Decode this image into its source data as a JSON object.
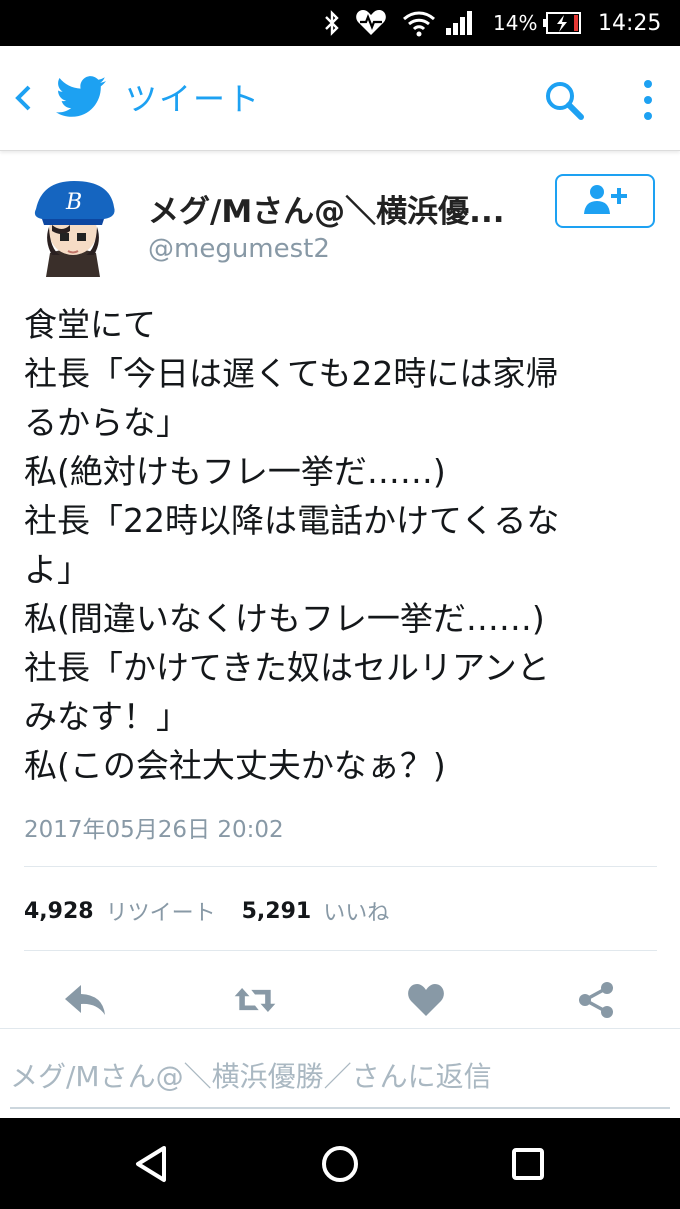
{
  "status_bar": {
    "battery_text": "14%",
    "time": "14:25",
    "icons": [
      "bluetooth-icon",
      "heart-monitor-icon",
      "wifi-icon",
      "signal-icon",
      "battery-icon"
    ]
  },
  "app_bar": {
    "title": "ツイート",
    "icons": [
      "back-icon",
      "twitter-bird-icon",
      "search-icon",
      "more-vert-icon"
    ],
    "accent_color": "#1da1f2"
  },
  "tweet": {
    "author_name": "メグ/Mさん@＼横浜優...",
    "author_handle": "@megumest2",
    "text_lines": [
      "食堂にて",
      "社長「今日は遅くても22時には家帰",
      "るからな」",
      "私(絶対けもフレ一挙だ……)",
      "社長「22時以降は電話かけてくるな",
      "よ」",
      "私(間違いなくけもフレ一挙だ……)",
      "社長「かけてきた奴はセルリアンと",
      "みなす！」",
      "私(この会社大丈夫かなぁ？)"
    ],
    "timestamp": "2017年05月26日 20:02",
    "retweet_count": "4,928",
    "retweet_label": "リツイート",
    "like_count": "5,291",
    "like_label": "いいね"
  },
  "actions": [
    "reply-icon",
    "retweet-icon",
    "like-icon",
    "share-icon"
  ],
  "reply": {
    "placeholder": "メグ/Mさん@＼横浜優勝／さんに返信"
  },
  "nav_bar": [
    "back-triangle-icon",
    "home-circle-icon",
    "recents-square-icon"
  ]
}
